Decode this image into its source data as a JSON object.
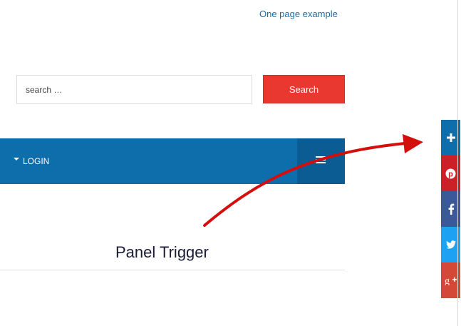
{
  "header": {
    "link_label": "One page example"
  },
  "search": {
    "placeholder": "search …",
    "button_label": "Search"
  },
  "nav": {
    "login_label": "LOGIN"
  },
  "annotation": {
    "label": "Panel Trigger",
    "arrow_color": "#d40d0d"
  },
  "share_panel": {
    "buttons": [
      {
        "name": "share-toggle",
        "icon": "plus-icon",
        "color": "#0e6dab",
        "glyph": "+"
      },
      {
        "name": "pinterest",
        "icon": "pinterest-icon",
        "color": "#cb2027",
        "glyph": "p"
      },
      {
        "name": "facebook",
        "icon": "facebook-icon",
        "color": "#3b5998",
        "glyph": "f"
      },
      {
        "name": "twitter",
        "icon": "twitter-icon",
        "color": "#1da1f2",
        "glyph": "t"
      },
      {
        "name": "google-plus",
        "icon": "google-plus-icon",
        "color": "#d34836",
        "glyph": "g+"
      }
    ]
  },
  "colors": {
    "nav_bg": "#0e6dab",
    "nav_toggle_bg": "#0b5c92",
    "search_button": "#e9382f",
    "link": "#1a6ea8"
  }
}
